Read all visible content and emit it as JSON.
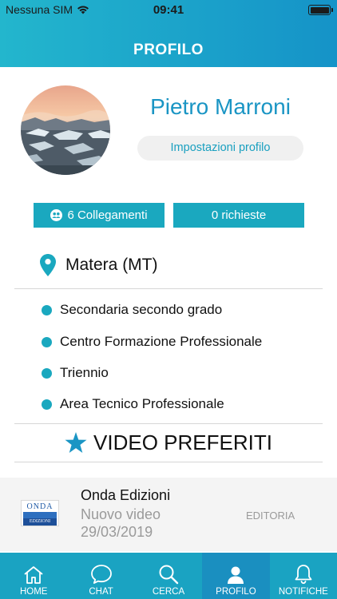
{
  "status_bar": {
    "carrier": "Nessuna SIM",
    "time": "09:41"
  },
  "header": {
    "title": "PROFILO"
  },
  "profile": {
    "name": "Pietro Marroni",
    "settings_label": "Impostazioni profilo",
    "connections_label": "6 Collegamenti",
    "requests_label": "0 richieste",
    "location": "Matera (MT)",
    "tags": [
      "Secondaria secondo grado",
      "Centro Formazione Professionale",
      "Triennio",
      "Area Tecnico Professionale"
    ]
  },
  "favorites": {
    "title": "VIDEO PREFERITI",
    "items": [
      {
        "publisher": "Onda Edizioni",
        "subtitle": "Nuovo video",
        "date": "29/03/2019",
        "category": "EDITORIA",
        "logo_top": "ONDA",
        "logo_bottom": "EDIZIONI"
      }
    ]
  },
  "tabbar": {
    "tabs": [
      {
        "label": "HOME",
        "icon": "home-icon"
      },
      {
        "label": "CHAT",
        "icon": "chat-icon"
      },
      {
        "label": "CERCA",
        "icon": "search-icon"
      },
      {
        "label": "PROFILO",
        "icon": "user-icon"
      },
      {
        "label": "NOTIFICHE",
        "icon": "bell-icon"
      }
    ],
    "active_index": 3
  },
  "colors": {
    "accent": "#1aa8bf",
    "header_start": "#23b6cd",
    "header_end": "#1593c8",
    "name": "#1a95c4"
  }
}
